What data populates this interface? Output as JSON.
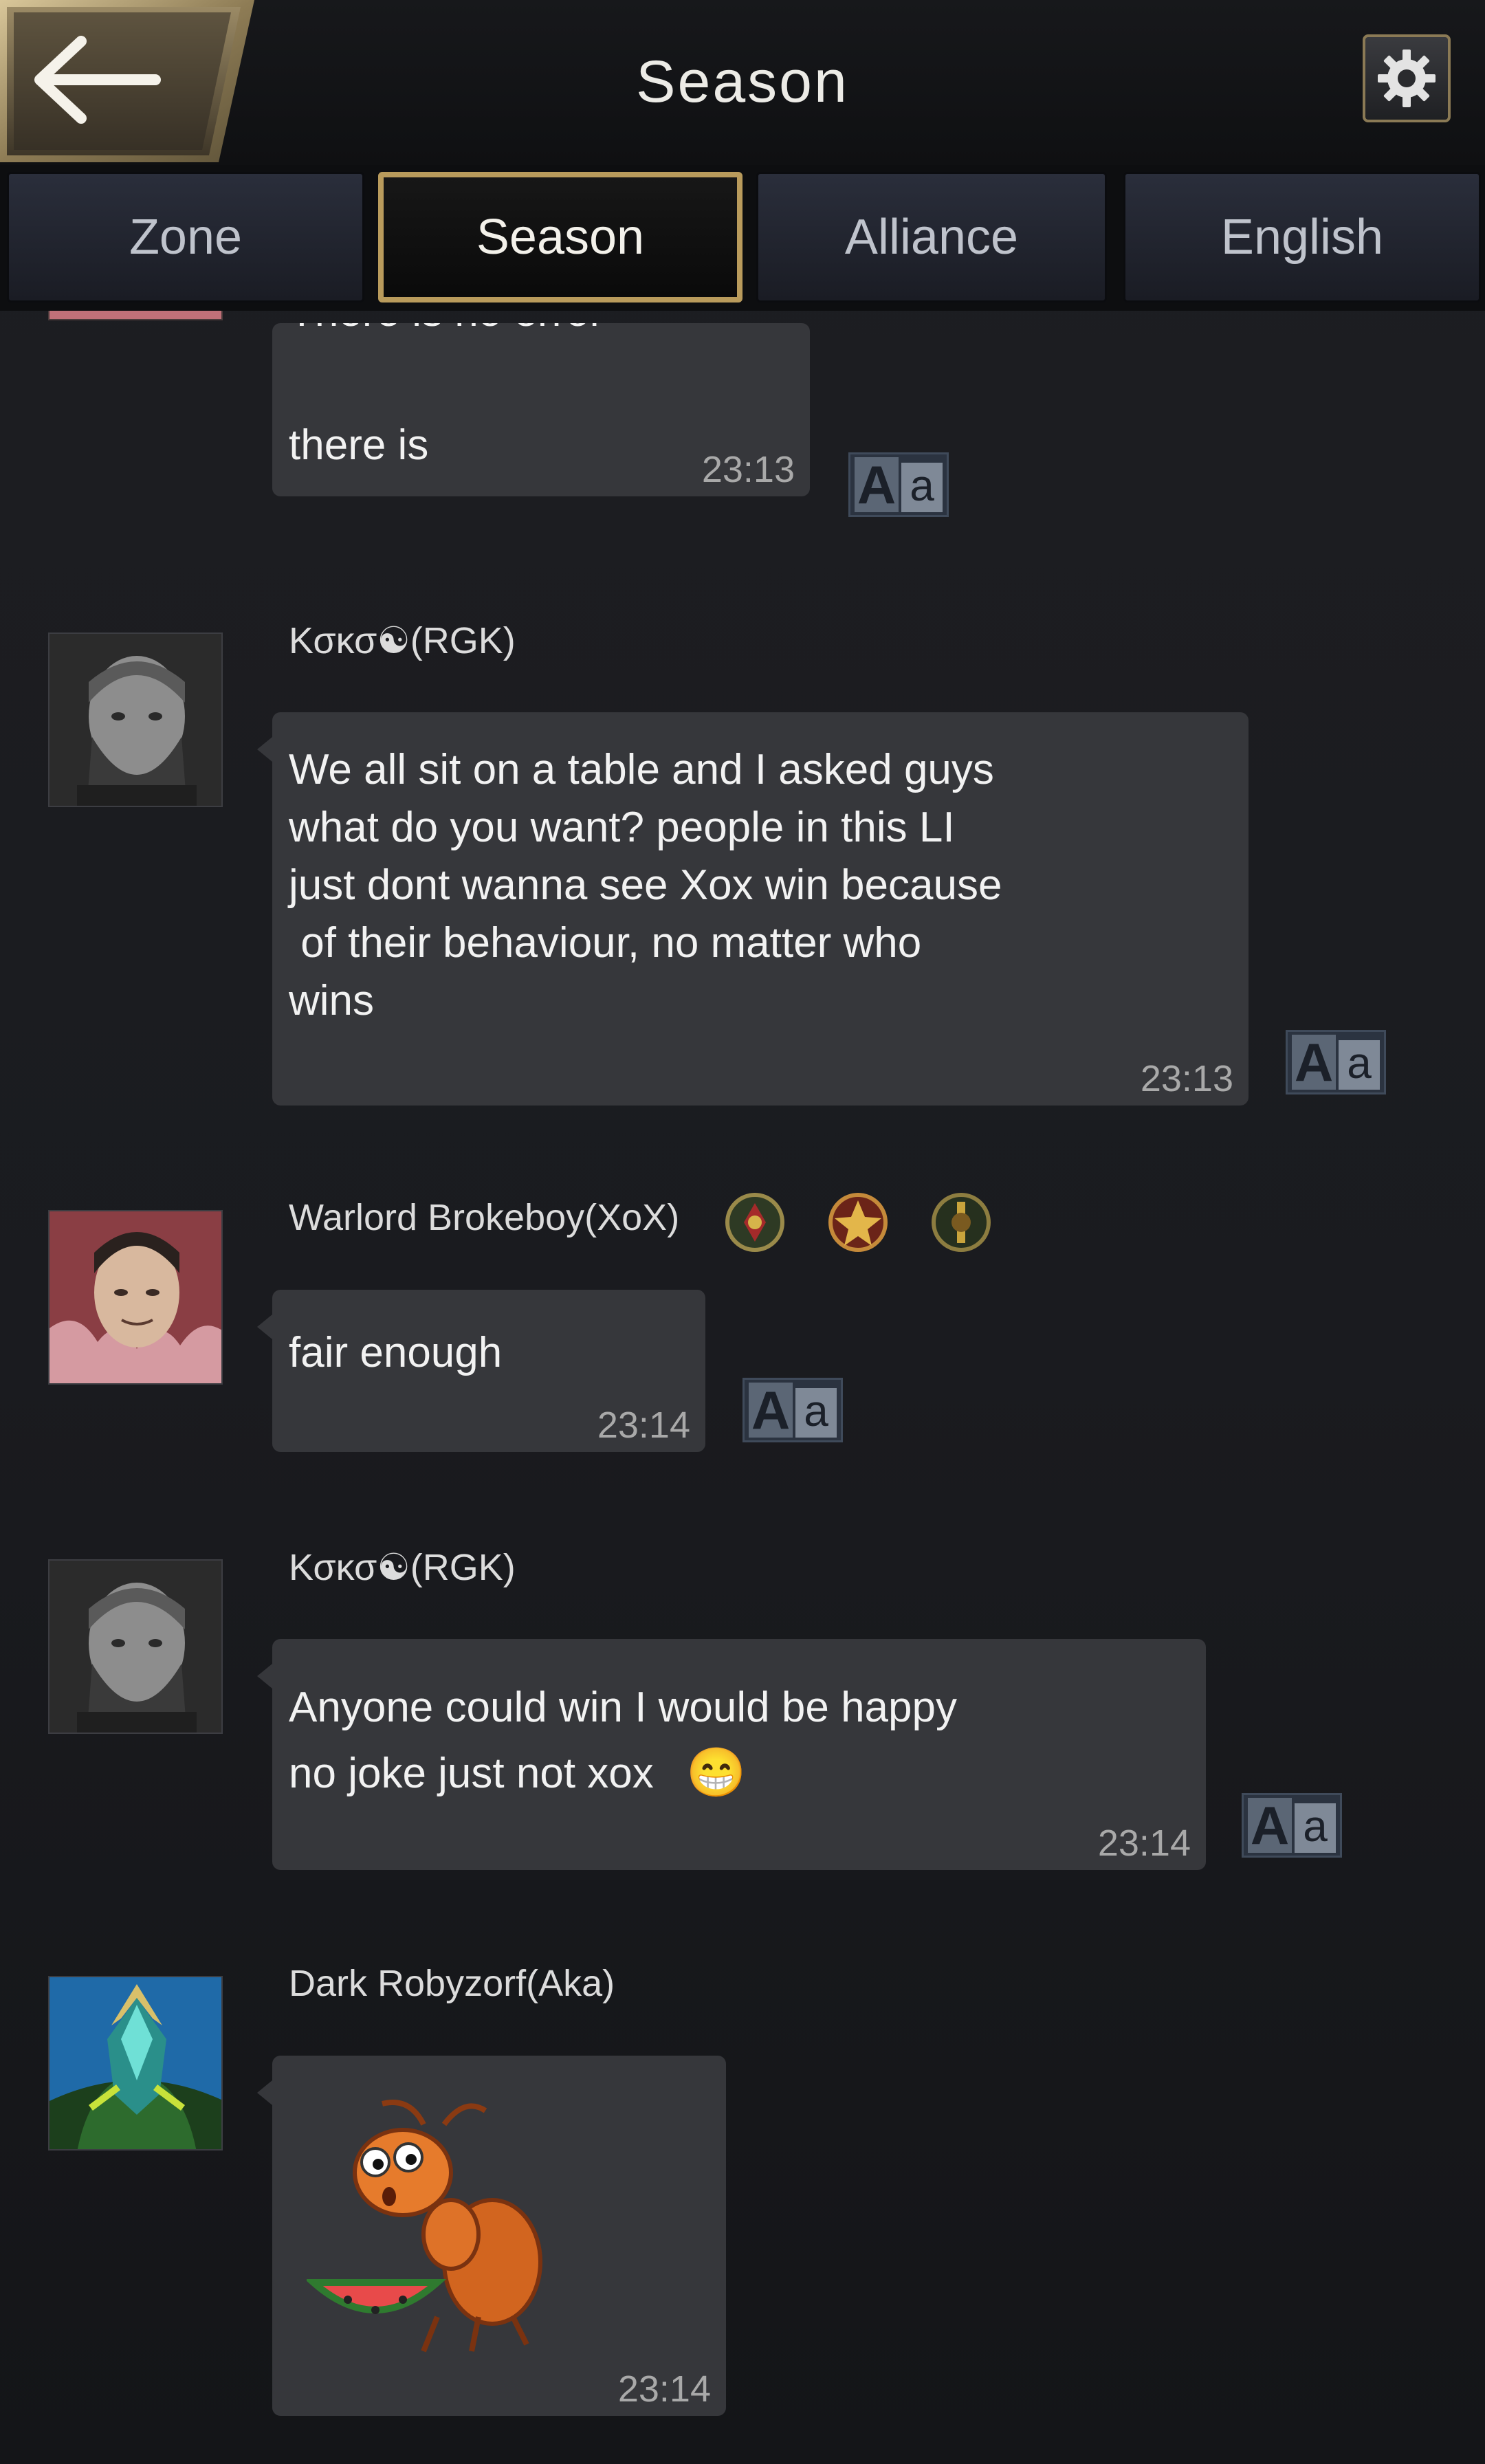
{
  "header": {
    "title": "Season"
  },
  "tabs": [
    {
      "label": "Zone",
      "active": false
    },
    {
      "label": "Season",
      "active": true
    },
    {
      "label": "Alliance",
      "active": false
    },
    {
      "label": "English",
      "active": false
    }
  ],
  "messages": [
    {
      "cut_text": "There is no error",
      "text": "there is",
      "time": "23:13"
    },
    {
      "user": "Κσκσ☯(RGK)",
      "text": "We all sit on a table and I asked guys\nwhat do you want? people in this LI\njust dont wanna see Xox win because\n of their behaviour, no matter who\nwins",
      "time": "23:13"
    },
    {
      "user": "Warlord Brokeboy(XoX)",
      "text": "fair enough",
      "time": "23:14"
    },
    {
      "user": "Κσκσ☯(RGK)",
      "text": "Anyone could win I would be happy\nno joke just not xox",
      "emoji": "😁",
      "time": "23:14"
    },
    {
      "user": "Dark Robyzorf(Aka)",
      "sticker": "ant-watermelon-sticker",
      "time": "23:14"
    }
  ],
  "translate": {
    "big": "A",
    "small": "a"
  },
  "colors": {
    "accent_gold": "#b99b5c",
    "bubble": "#36373b",
    "background": "#1b1c20"
  }
}
